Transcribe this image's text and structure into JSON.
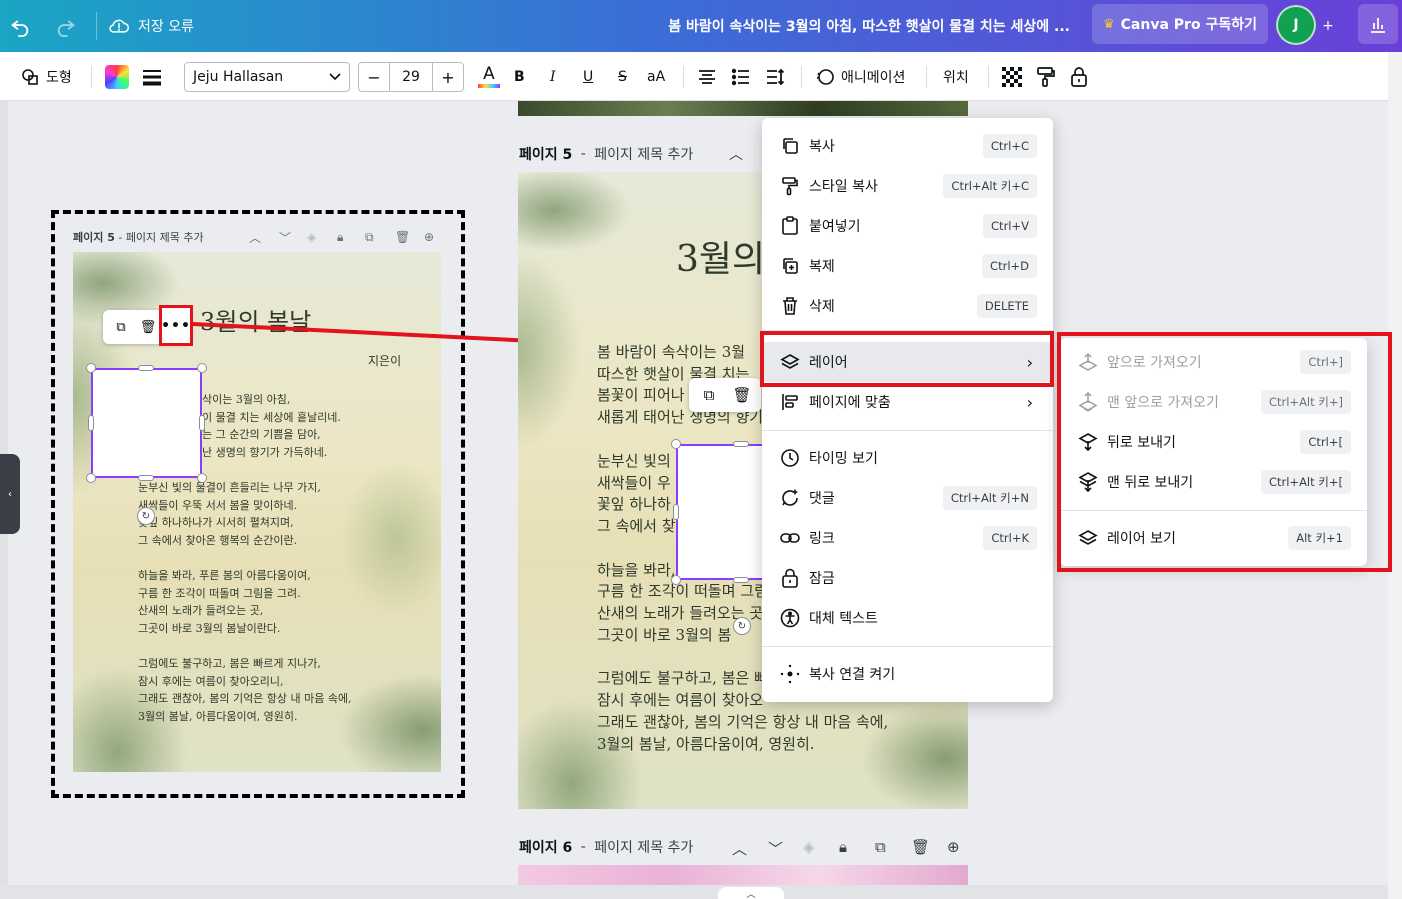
{
  "topbar": {
    "save_status": "저장 오류",
    "doc_title": "봄 바람이 속삭이는 3월의 아침, 따스한 햇살이 물결 치는 세상에 ...",
    "pro_label": "Canva Pro 구독하기",
    "avatar_letter": "J",
    "plus": "+"
  },
  "toolbar": {
    "shape_label": "도형",
    "font_name": "Jeju Hallasan",
    "font_size": "29",
    "minus": "−",
    "plus": "+",
    "text_color_glyph": "A",
    "bold": "B",
    "italic": "I",
    "underline": "U",
    "strike": "S",
    "case": "aA",
    "animate_label": "애니메이션",
    "position_label": "위치"
  },
  "preview": {
    "header_page": "페이지 5",
    "header_sep": " - ",
    "header_title": "페이지 제목 추가",
    "title": "3월의 봄날",
    "author": "지은이",
    "stanzas": [
      "삭이는 3월의 아침,\n이 물결 치는 세상에 흩날리네.\n는 그 순간의 기쁨을 담아,\n난 생명의 향기가 가득하네.",
      "눈부신 빛의 물결이 흔들리는 나무 가지,\n새싹들이 우뚝 서서 봄을 맞이하네.\n꽃잎 하나하나가 시서히 펼쳐지며,\n그 속에서 찾아온 행복의 순간이란.",
      "하늘을 봐라, 푸른 봄의 아름다움이여,\n구름 한 조각이 떠돌며 그림을 그려.\n산새의 노래가 들려오는 곳,\n그곳이 바로 3월의 봄날이란다.",
      "그럼에도 불구하고, 봄은 빠르게 지나가,\n잠시 후에는 여름이 찾아오리니,\n그래도 괜찮아, 봄의 기억은 항상 내 마음 속에,\n3월의 봄날, 아름다움이여, 영원히."
    ],
    "more_glyph": "•••"
  },
  "canvas": {
    "page5_label": "페이지 5",
    "page5_sep": " - ",
    "page5_title": "페이지 제목 추가",
    "page6_label": "페이지 6",
    "page6_sep": " - ",
    "page6_title": "페이지 제목 추가",
    "main_title": "3월의",
    "main_stanzas": [
      "봄 바람이 속삭이는 3월\n따스한 햇살이 물결 치는\n봄꽃이 피어나\n새롭게 태어난 생명의 향기",
      "눈부신 빛의\n새싹들이 우\n꽃잎 하나하\n그 속에서 찾",
      "하늘을 봐라,\n구름 한 조각이 떠돌며 그림\n산새의 노래가 들려오는 곳\n그곳이 바로 3월의 봄",
      "그럼에도 불구하고, 봄은 빠\n잠시 후에는 여름이 찾아오\n그래도 괜찮아, 봄의 기억은 항상 내 마음 속에,\n3월의 봄날, 아름다움이여, 영원히."
    ]
  },
  "context_menu": {
    "items": [
      {
        "label": "복사",
        "shortcut": "Ctrl+C"
      },
      {
        "label": "스타일 복사",
        "shortcut": "Ctrl+Alt 키+C"
      },
      {
        "label": "붙여넣기",
        "shortcut": "Ctrl+V"
      },
      {
        "label": "복제",
        "shortcut": "Ctrl+D"
      },
      {
        "label": "삭제",
        "shortcut": "DELETE"
      },
      {
        "label": "레이어",
        "shortcut": ""
      },
      {
        "label": "페이지에 맞춤",
        "shortcut": ""
      },
      {
        "label": "타이밍 보기",
        "shortcut": ""
      },
      {
        "label": "댓글",
        "shortcut": "Ctrl+Alt 키+N"
      },
      {
        "label": "링크",
        "shortcut": "Ctrl+K"
      },
      {
        "label": "잠금",
        "shortcut": ""
      },
      {
        "label": "대체 텍스트",
        "shortcut": ""
      },
      {
        "label": "복사 연결 켜기",
        "shortcut": ""
      }
    ]
  },
  "layer_submenu": {
    "items": [
      {
        "label": "앞으로 가져오기",
        "shortcut": "Ctrl+]",
        "disabled": true
      },
      {
        "label": "맨 앞으로 가져오기",
        "shortcut": "Ctrl+Alt 키+]",
        "disabled": true
      },
      {
        "label": "뒤로 보내기",
        "shortcut": "Ctrl+[",
        "disabled": false
      },
      {
        "label": "맨 뒤로 보내기",
        "shortcut": "Ctrl+Alt 키+[",
        "disabled": false
      },
      {
        "label": "레이어 보기",
        "shortcut": "Alt 키+1",
        "disabled": false
      }
    ]
  },
  "colors": {
    "accent_purple": "#8b3dff",
    "annotation_red": "#e1141e",
    "avatar_green": "#12a150"
  },
  "icons": [
    "undo-icon",
    "redo-icon",
    "cloud-error-icon",
    "crown-icon",
    "chart-icon",
    "shape-icon",
    "color-swatch-icon",
    "line-weight-icon",
    "chevron-down-icon",
    "align-icon",
    "list-icon",
    "spacing-icon",
    "animate-icon",
    "transparency-icon",
    "paint-format-icon",
    "lock-icon",
    "copy-icon",
    "paint-roller-icon",
    "clipboard-icon",
    "duplicate-icon",
    "trash-icon",
    "layers-icon",
    "align-page-icon",
    "clock-icon",
    "comment-icon",
    "link-icon",
    "alt-text-icon",
    "link-dots-icon",
    "bring-forward-icon",
    "bring-front-icon",
    "send-backward-icon",
    "send-back-icon",
    "rotate-icon",
    "more-icon"
  ]
}
